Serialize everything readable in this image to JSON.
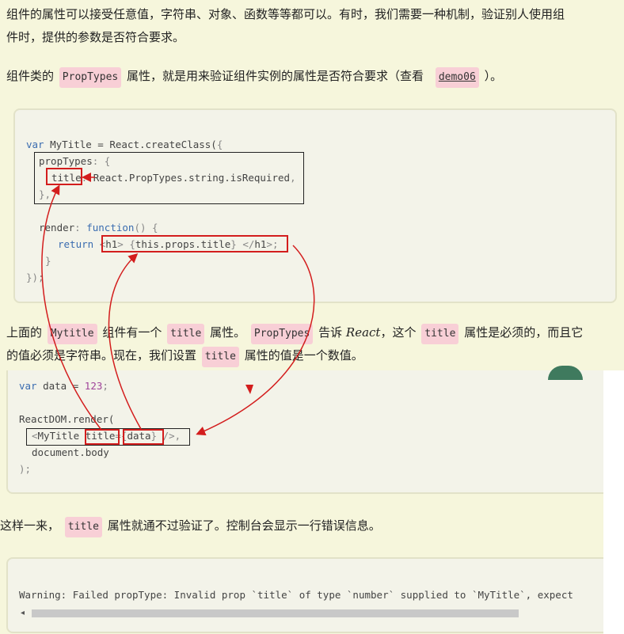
{
  "para1": {
    "line1": "组件的属性可以接受任意值，字符串、对象、函数等等都可以。有时，我们需要一种机制，验证别人使用组",
    "line2": "件时，提供的参数是否符合要求。"
  },
  "para2": {
    "pre": "组件类的",
    "code": "PropTypes",
    "mid": "属性，就是用来验证组件实例的属性是否符合要求（查看",
    "link": "demo06",
    "post": "）。"
  },
  "code1": [
    {
      "parts": [
        [
          "kw",
          "var"
        ],
        [
          "t",
          " MyTitle = React.createClass("
        ],
        [
          "punc",
          "{"
        ]
      ]
    },
    {
      "parts": [
        [
          "t",
          "propTypes"
        ],
        [
          "punc",
          ": {"
        ]
      ]
    },
    {
      "parts": [
        [
          "t",
          "title"
        ],
        [
          "punc",
          ": "
        ],
        [
          "t",
          "React.PropTypes.string.isRequired"
        ],
        [
          "punc",
          ","
        ]
      ]
    },
    {
      "parts": [
        [
          "punc",
          "},"
        ]
      ]
    },
    {
      "parts": [
        [
          "t",
          "render"
        ],
        [
          "punc",
          ": "
        ],
        [
          "kw",
          "function"
        ],
        [
          "punc",
          "() {"
        ]
      ]
    },
    {
      "parts": [
        [
          "kw",
          "return"
        ],
        [
          "t",
          " "
        ],
        [
          "punc",
          "<"
        ],
        [
          "t",
          "h1"
        ],
        [
          "punc",
          "> {"
        ],
        [
          "t",
          "this.props.title"
        ],
        [
          "punc",
          "} </"
        ],
        [
          "t",
          "h1"
        ],
        [
          "punc",
          ">;"
        ]
      ]
    },
    {
      "parts": [
        [
          "punc",
          "}"
        ]
      ]
    },
    {
      "parts": [
        [
          "punc",
          "});"
        ]
      ]
    }
  ],
  "para3": {
    "t1": "上面的",
    "c1": "Mytitle",
    "t2": "组件有一个",
    "c2": "title",
    "t3": "属性。",
    "c3": "PropTypes",
    "t4": "告诉",
    "em": "React",
    "t5": "，这个",
    "c4": "title",
    "t6": "属性是必须的，而且它",
    "line2a": "的值必须是字符串。现在，我们设置",
    "c5": "title",
    "line2b": "属性的值是一个数值。"
  },
  "code2": [
    {
      "parts": [
        [
          "kw",
          "var"
        ],
        [
          "t",
          " data = "
        ],
        [
          "num",
          "123"
        ],
        [
          "punc",
          ";"
        ]
      ]
    },
    {
      "parts": [
        [
          "t",
          ""
        ]
      ]
    },
    {
      "parts": [
        [
          "t",
          "ReactDOM.render("
        ]
      ]
    },
    {
      "parts": [
        [
          "punc",
          "<"
        ],
        [
          "t",
          "MyTitle title"
        ],
        [
          "punc",
          "={"
        ],
        [
          "t",
          "data"
        ],
        [
          "punc",
          "} />,"
        ]
      ]
    },
    {
      "parts": [
        [
          "t",
          "document.body"
        ]
      ]
    },
    {
      "parts": [
        [
          "punc",
          ");"
        ]
      ]
    }
  ],
  "para4": {
    "pre": "这样一来，",
    "code": "title",
    "post": "属性就通不过验证了。控制台会显示一行错误信息。"
  },
  "code3": {
    "line": "Warning: Failed propType: Invalid prop `title` of type `number` supplied to `MyTitle`, expect"
  },
  "scrollbar": {
    "left_arrow": "◂",
    "right_arrow": "▸"
  },
  "colors": {
    "page_bg": "#f6f6dc",
    "inline_code_bg": "#f8cfd6",
    "highlight_red": "#d31d1d",
    "keyword_blue": "#3a6cb0"
  }
}
